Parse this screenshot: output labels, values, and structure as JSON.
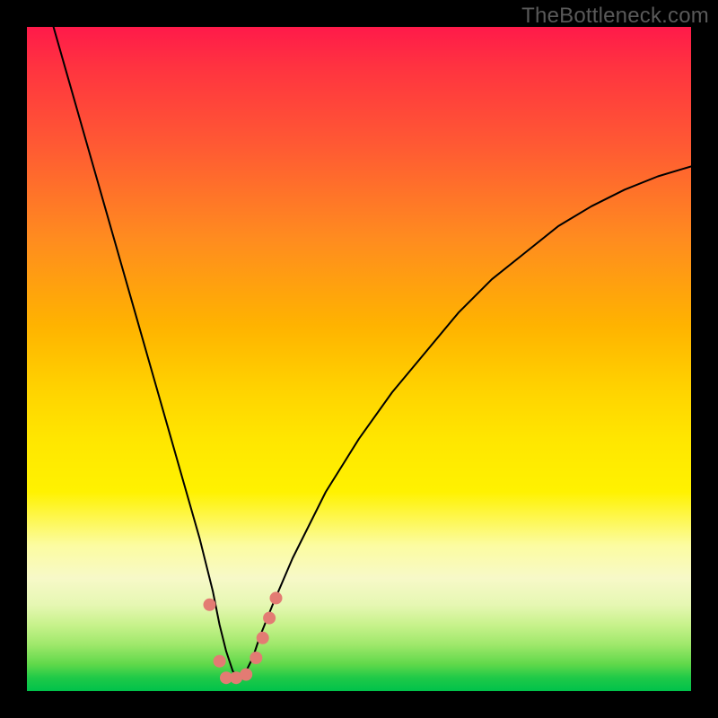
{
  "watermark": "TheBottleneck.com",
  "chart_data": {
    "type": "line",
    "title": "",
    "xlabel": "",
    "ylabel": "",
    "xlim": [
      0,
      100
    ],
    "ylim": [
      0,
      100
    ],
    "series": [
      {
        "name": "bottleneck-curve",
        "x": [
          4,
          6,
          8,
          10,
          12,
          14,
          16,
          18,
          20,
          22,
          24,
          26,
          28,
          29,
          30,
          31,
          32,
          33,
          34,
          35,
          37,
          40,
          45,
          50,
          55,
          60,
          65,
          70,
          75,
          80,
          85,
          90,
          95,
          100
        ],
        "y": [
          100,
          93,
          86,
          79,
          72,
          65,
          58,
          51,
          44,
          37,
          30,
          23,
          15,
          10,
          6,
          3,
          2,
          3,
          5,
          8,
          13,
          20,
          30,
          38,
          45,
          51,
          57,
          62,
          66,
          70,
          73,
          75.5,
          77.5,
          79
        ]
      }
    ],
    "markers": {
      "name": "highlight-points",
      "color": "#e37b73",
      "x": [
        27.5,
        29.0,
        30.0,
        31.5,
        33.0,
        34.5,
        35.5,
        36.5,
        37.5
      ],
      "y": [
        13.0,
        4.5,
        2.0,
        2.0,
        2.5,
        5.0,
        8.0,
        11.0,
        14.0
      ]
    },
    "background_gradient": {
      "direction": "top-to-bottom",
      "stops": [
        {
          "pos": 0.0,
          "color": "#ff1a4a"
        },
        {
          "pos": 0.32,
          "color": "#ff8c1f"
        },
        {
          "pos": 0.55,
          "color": "#ffd400"
        },
        {
          "pos": 0.78,
          "color": "#fcfca0"
        },
        {
          "pos": 0.9,
          "color": "#c8f28c"
        },
        {
          "pos": 1.0,
          "color": "#00c24a"
        }
      ]
    }
  }
}
